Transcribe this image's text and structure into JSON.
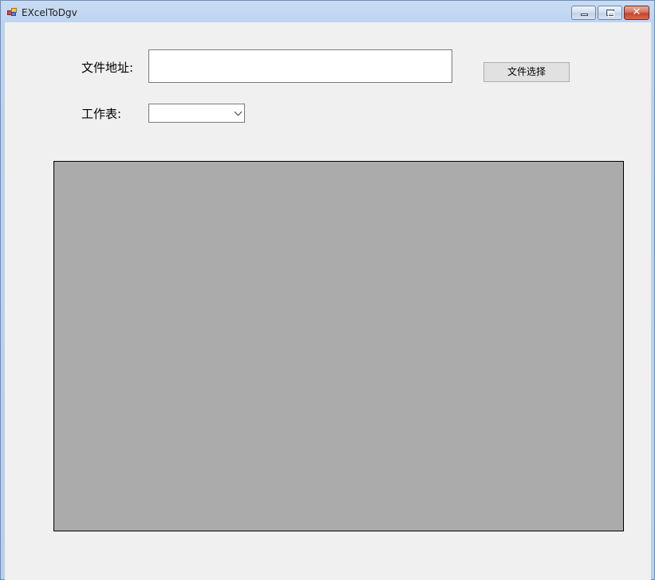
{
  "window": {
    "title": "EXcelToDgv"
  },
  "form": {
    "file_path_label": "文件地址:",
    "file_path_value": "",
    "file_select_button": "文件选择",
    "sheet_label": "工作表:",
    "sheet_selected": ""
  },
  "grid": {
    "columns": [],
    "rows": []
  },
  "colors": {
    "client_background": "#f0f0f0",
    "grid_background": "#ababab"
  }
}
